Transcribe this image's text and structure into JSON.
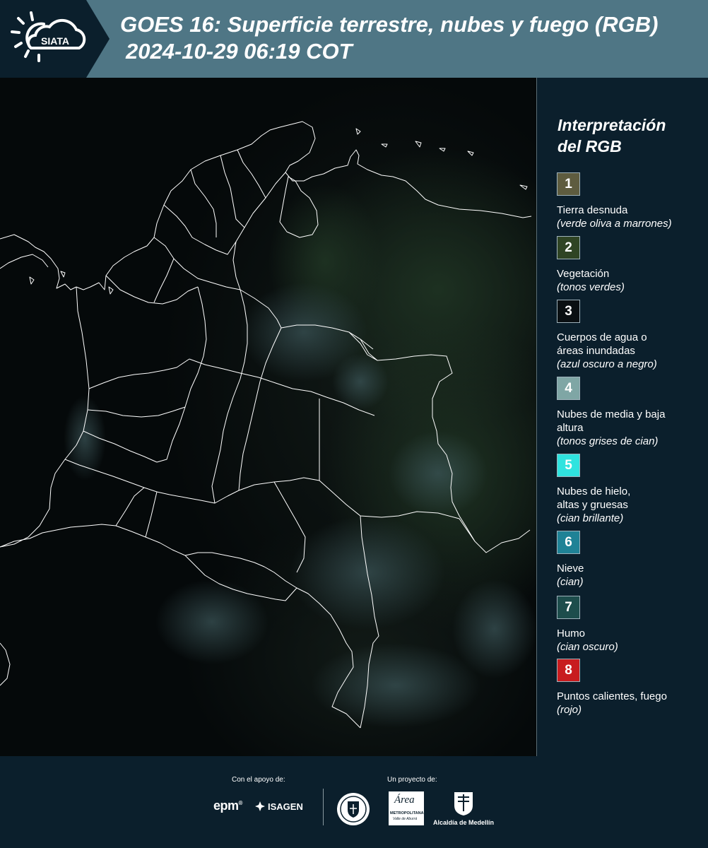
{
  "header": {
    "logo_text": "SIATA",
    "title_line1": "GOES 16: Superficie terrestre, nubes y fuego (RGB)",
    "title_line2": "2024-10-29 06:19 COT"
  },
  "legend": {
    "title_line1": "Interpretación",
    "title_line2": "del RGB",
    "items": [
      {
        "number": "1",
        "label": "Tierra desnuda",
        "desc": "(verde oliva a marrones)",
        "color": "#5e5c3f"
      },
      {
        "number": "2",
        "label": "Vegetación",
        "desc": "(tonos verdes)",
        "color": "#2f4424"
      },
      {
        "number": "3",
        "label": "Cuerpos de agua o áreas inundadas",
        "desc": "(azul oscuro a negro)",
        "color": "#0a0f12"
      },
      {
        "number": "4",
        "label": "Nubes de media y baja altura",
        "desc": "(tonos grises de cian)",
        "color": "#7fa6a5"
      },
      {
        "number": "5",
        "label": "Nubes de hielo, altas y gruesas",
        "desc": "(cian brillante)",
        "color": "#2fe3df"
      },
      {
        "number": "6",
        "label": "Nieve",
        "desc": "(cian)",
        "color": "#1f8296"
      },
      {
        "number": "7",
        "label": "Humo",
        "desc": "(cian oscuro)",
        "color": "#1d4d4c"
      },
      {
        "number": "8",
        "label": "Puntos calientes, fuego",
        "desc": "(rojo)",
        "color": "#c81c1f"
      }
    ]
  },
  "footer": {
    "support_label": "Con el apoyo de:",
    "project_label": "Un proyecto de:",
    "logo_epm": "epm",
    "logo_isagen": "ISAGEN",
    "logo_area_1": "Área",
    "logo_area_2": "METROPOLITANA",
    "logo_area_3": "Valle de Aburrá",
    "logo_alcaldia": "Alcaldía de Medellín"
  }
}
